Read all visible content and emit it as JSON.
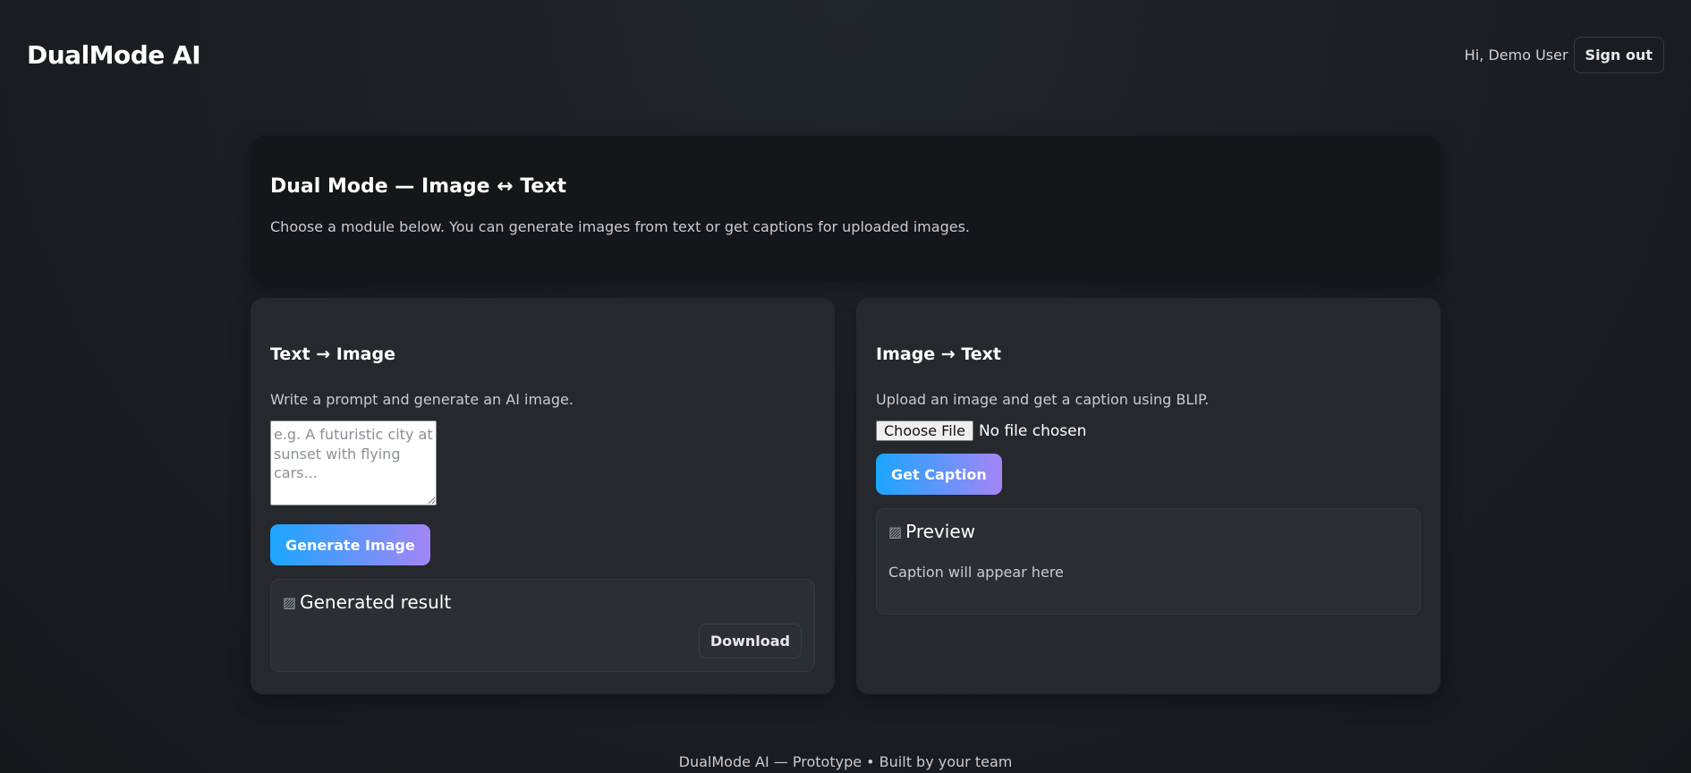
{
  "app": {
    "brand": "DualMode AI",
    "greeting": "Hi, Demo User",
    "sign_out_label": "Sign out"
  },
  "hero": {
    "title": "Dual Mode — Image ↔ Text",
    "subtitle": "Choose a module below. You can generate images from text or get captions for uploaded images."
  },
  "text_to_image": {
    "title": "Text → Image",
    "description": "Write a prompt and generate an AI image.",
    "prompt_placeholder": "e.g. A futuristic city at sunset with flying cars...",
    "generate_label": "Generate Image",
    "result_alt": "Generated result",
    "download_label": "Download"
  },
  "image_to_text": {
    "title": "Image → Text",
    "description": "Upload an image and get a caption using BLIP.",
    "choose_file_label": "Choose File",
    "file_status": "No file chosen",
    "get_caption_label": "Get Caption",
    "preview_alt": "Preview",
    "caption_placeholder": "Caption will appear here"
  },
  "footer": {
    "text": "DualMode AI — Prototype • Built by your team"
  },
  "colors": {
    "accent_start": "#1aa6ff",
    "accent_end": "#a485f5",
    "card_bg": "#25282d",
    "hero_bg": "#14161a"
  }
}
